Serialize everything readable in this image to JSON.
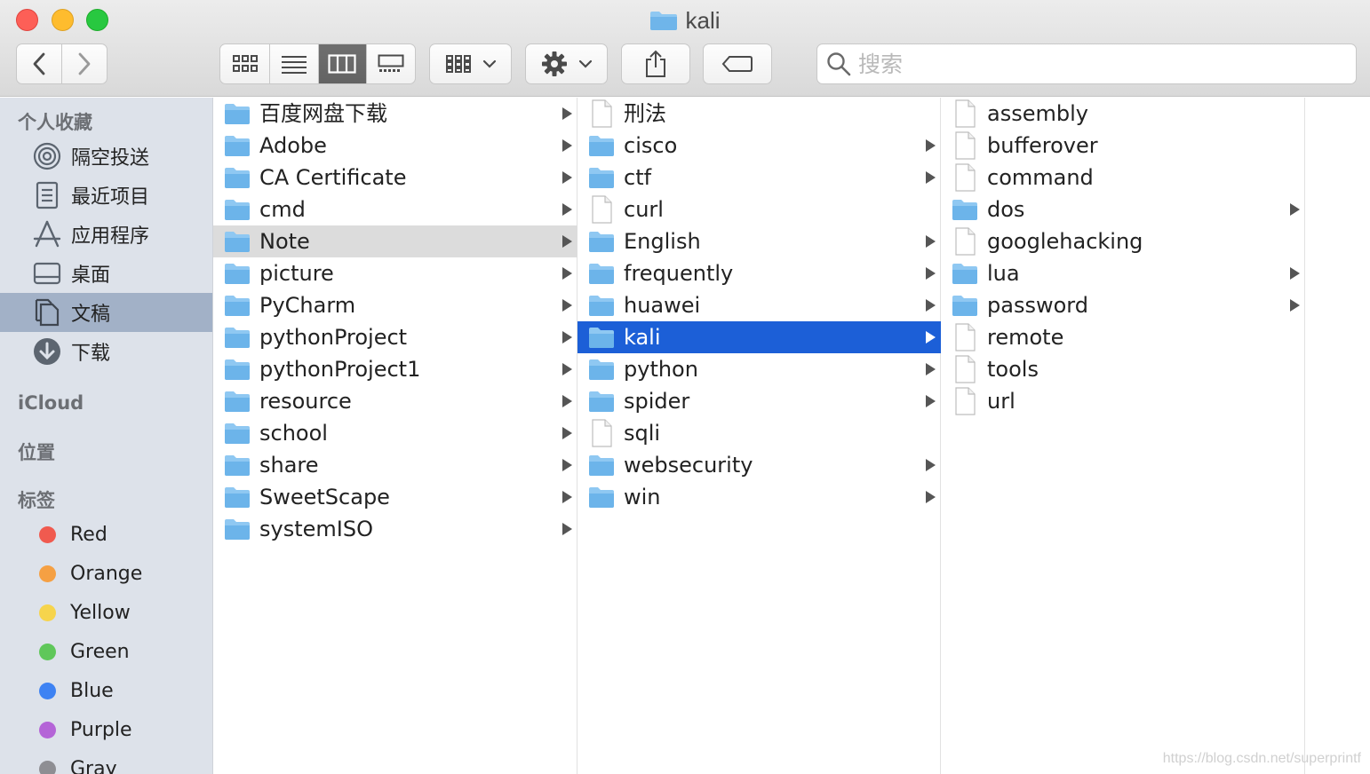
{
  "window": {
    "title": "kali"
  },
  "toolbar": {
    "back": "back",
    "forward": "forward",
    "view_modes": [
      "icon-view",
      "list-view",
      "column-view",
      "gallery-view"
    ],
    "active_view": "column-view",
    "group": "group-by",
    "action": "action",
    "share": "share",
    "tag": "edit-tags",
    "search_placeholder": "搜索"
  },
  "sidebar": {
    "favorites_header": "个人收藏",
    "favorites": [
      {
        "label": "隔空投送",
        "icon": "airdrop-icon"
      },
      {
        "label": "最近项目",
        "icon": "recents-icon"
      },
      {
        "label": "应用程序",
        "icon": "applications-icon"
      },
      {
        "label": "桌面",
        "icon": "desktop-icon"
      },
      {
        "label": "文稿",
        "icon": "documents-icon",
        "selected": true
      },
      {
        "label": "下载",
        "icon": "downloads-icon"
      }
    ],
    "icloud_header": "iCloud",
    "locations_header": "位置",
    "tags_header": "标签",
    "tags": [
      {
        "label": "Red",
        "color": "#f05a4f"
      },
      {
        "label": "Orange",
        "color": "#f5a043"
      },
      {
        "label": "Yellow",
        "color": "#f6d44c"
      },
      {
        "label": "Green",
        "color": "#5fc75a"
      },
      {
        "label": "Blue",
        "color": "#3d82f3"
      },
      {
        "label": "Purple",
        "color": "#b464d7"
      },
      {
        "label": "Gray",
        "color": "#8e8e93"
      }
    ]
  },
  "columns": [
    {
      "items": [
        {
          "name": "百度网盘下载",
          "type": "folder"
        },
        {
          "name": "Adobe",
          "type": "folder"
        },
        {
          "name": "CA Certificate",
          "type": "folder"
        },
        {
          "name": "cmd",
          "type": "folder"
        },
        {
          "name": "Note",
          "type": "folder",
          "state": "path"
        },
        {
          "name": "picture",
          "type": "folder"
        },
        {
          "name": "PyCharm",
          "type": "folder"
        },
        {
          "name": "pythonProject",
          "type": "folder"
        },
        {
          "name": "pythonProject1",
          "type": "folder"
        },
        {
          "name": "resource",
          "type": "folder"
        },
        {
          "name": "school",
          "type": "folder"
        },
        {
          "name": "share",
          "type": "folder"
        },
        {
          "name": "SweetScape",
          "type": "folder"
        },
        {
          "name": "systemISO",
          "type": "folder"
        }
      ]
    },
    {
      "items": [
        {
          "name": "刑法",
          "type": "file"
        },
        {
          "name": "cisco",
          "type": "folder"
        },
        {
          "name": "ctf",
          "type": "folder"
        },
        {
          "name": "curl",
          "type": "file"
        },
        {
          "name": "English",
          "type": "folder"
        },
        {
          "name": "frequently",
          "type": "folder"
        },
        {
          "name": "huawei",
          "type": "folder"
        },
        {
          "name": "kali",
          "type": "folder",
          "state": "active"
        },
        {
          "name": "python",
          "type": "folder"
        },
        {
          "name": "spider",
          "type": "folder"
        },
        {
          "name": "sqli",
          "type": "file"
        },
        {
          "name": "websecurity",
          "type": "folder"
        },
        {
          "name": "win",
          "type": "folder"
        }
      ]
    },
    {
      "items": [
        {
          "name": "assembly",
          "type": "file"
        },
        {
          "name": "bufferover",
          "type": "file"
        },
        {
          "name": "command",
          "type": "file"
        },
        {
          "name": "dos",
          "type": "folder"
        },
        {
          "name": "googlehacking",
          "type": "file"
        },
        {
          "name": "lua",
          "type": "folder"
        },
        {
          "name": "password",
          "type": "folder"
        },
        {
          "name": "remote",
          "type": "file"
        },
        {
          "name": "tools",
          "type": "file"
        },
        {
          "name": "url",
          "type": "file"
        }
      ]
    }
  ],
  "watermark": "https://blog.csdn.net/superprintf"
}
